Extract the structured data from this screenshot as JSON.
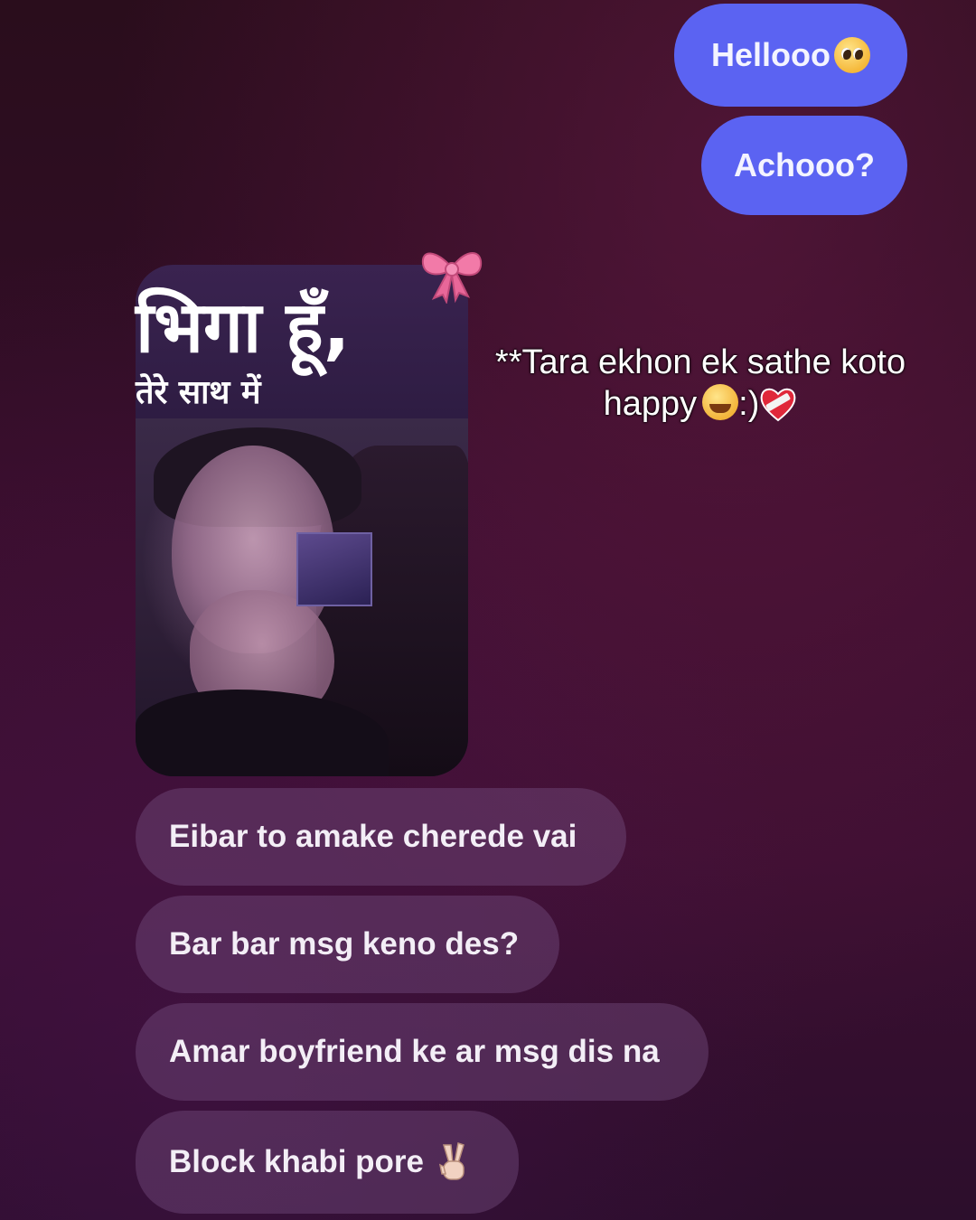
{
  "sent_messages": [
    {
      "text": "Hellooo",
      "emoji": "pleading-face-emoji"
    },
    {
      "text": "Achooo?"
    }
  ],
  "shared_post": {
    "title_hindi": "भिगा हूँ,",
    "subtitle_hindi": "तेरे साथ में",
    "decoration": "pink-bow-icon"
  },
  "overlay_caption": {
    "line1": "**Tara ekhon ek sathe koto",
    "line2": "happy",
    "suffix": ":)"
  },
  "received_messages": [
    {
      "text": "Eibar to amake cherede vai"
    },
    {
      "text": "Bar bar msg keno des?"
    },
    {
      "text": "Amar boyfriend ke ar msg dis na"
    },
    {
      "text": "Block khabi pore",
      "emoji": "victory-hand-emoji"
    }
  ],
  "colors": {
    "sent_bubble": "#5b63f2",
    "received_bubble": "rgba(120,80,130,0.42)",
    "background": "#3a0e2c"
  }
}
